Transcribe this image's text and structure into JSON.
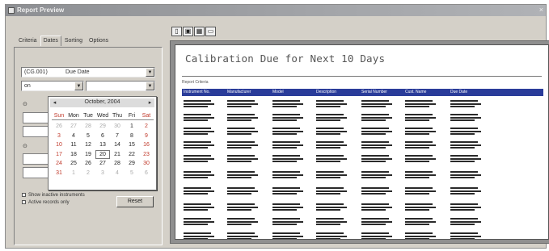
{
  "window": {
    "title": "Report Preview",
    "close_glyph": "×"
  },
  "tabs": [
    {
      "label": "Criteria",
      "active": false
    },
    {
      "label": "Dates",
      "active": true
    },
    {
      "label": "Sorting",
      "active": false
    },
    {
      "label": "Options",
      "active": false
    }
  ],
  "filters": {
    "date_field": "(CG.001)",
    "date_field_label": "Due Date",
    "operator": "on",
    "date_value": ""
  },
  "calendar": {
    "month_label": "October, 2004",
    "prev_glyph": "◂",
    "next_glyph": "▸",
    "weekdays": [
      "Sun",
      "Mon",
      "Tue",
      "Wed",
      "Thu",
      "Fri",
      "Sat"
    ],
    "weeks": [
      [
        "26",
        "27",
        "28",
        "29",
        "30",
        "1",
        "2"
      ],
      [
        "3",
        "4",
        "5",
        "6",
        "7",
        "8",
        "9"
      ],
      [
        "10",
        "11",
        "12",
        "13",
        "14",
        "15",
        "16"
      ],
      [
        "17",
        "18",
        "19",
        "20",
        "21",
        "22",
        "23"
      ],
      [
        "24",
        "25",
        "26",
        "27",
        "28",
        "29",
        "30"
      ],
      [
        "31",
        "1",
        "2",
        "3",
        "4",
        "5",
        "6"
      ]
    ],
    "today": "20"
  },
  "options": {
    "radio_a": "⊙",
    "radio_b": "⊙",
    "check_1": "Show inactive instruments",
    "check_2": "Active records only",
    "button_label": "Reset"
  },
  "toolbar": {
    "tools": [
      {
        "name": "page-icon",
        "glyph": "▯"
      },
      {
        "name": "print-icon",
        "glyph": "▣"
      },
      {
        "name": "export-icon",
        "glyph": "▦"
      },
      {
        "name": "window-icon",
        "glyph": "▭"
      }
    ]
  },
  "report": {
    "title": "Calibration Due for Next 10 Days",
    "subtitle": "Report Criteria",
    "columns": [
      "Instrument No.",
      "Manufacturer",
      "Model",
      "Description",
      "Serial Number",
      "Cust. Name",
      "Due Date"
    ]
  }
}
